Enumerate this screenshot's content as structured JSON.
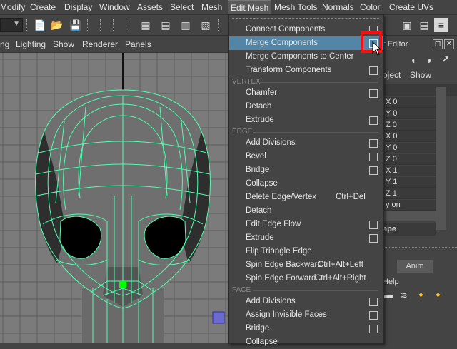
{
  "menubar": {
    "items": [
      "Modify",
      "Create",
      "Display",
      "Window",
      "Assets",
      "Select",
      "Mesh",
      "Edit Mesh",
      "Mesh Tools",
      "Normals",
      "Color",
      "Create UVs"
    ],
    "active": "Edit Mesh"
  },
  "viewport_menu": {
    "items": [
      "ng",
      "Lighting",
      "Show",
      "Renderer",
      "Panels"
    ]
  },
  "right_panel": {
    "title_fragment": "r Editor",
    "tab_object": "oject",
    "tab_show": "Show",
    "attr_rows": [
      "X 0",
      "Y 0",
      "Z 0",
      "X 0",
      "Y 0",
      "Z 0",
      "X 1",
      "Y 1",
      "Z 1",
      "y on"
    ],
    "section_label": "ape",
    "tab_anim": "Anim",
    "help_label": "Help"
  },
  "edit_mesh_menu": {
    "items": [
      {
        "label": "Connect Components",
        "option": true
      },
      {
        "label": "Merge Components",
        "option": true,
        "highlighted": true
      },
      {
        "label": "Merge Components to Center",
        "option": false
      },
      {
        "label": "Transform Components",
        "option": true
      },
      {
        "section": "VERTEX"
      },
      {
        "label": "Chamfer",
        "option": true
      },
      {
        "label": "Detach",
        "option": false
      },
      {
        "label": "Extrude",
        "option": true
      },
      {
        "section": "EDGE"
      },
      {
        "label": "Add Divisions",
        "option": true
      },
      {
        "label": "Bevel",
        "option": true
      },
      {
        "label": "Bridge",
        "option": true
      },
      {
        "label": "Collapse",
        "option": false
      },
      {
        "label": "Delete Edge/Vertex",
        "shortcut": "Ctrl+Del",
        "option": false
      },
      {
        "label": "Detach",
        "option": false
      },
      {
        "label": "Edit Edge Flow",
        "option": true
      },
      {
        "label": "Extrude",
        "option": true
      },
      {
        "label": "Flip Triangle Edge",
        "option": false
      },
      {
        "label": "Spin Edge Backward",
        "shortcut": "Ctrl+Alt+Left",
        "option": false
      },
      {
        "label": "Spin Edge Forward",
        "shortcut": "Ctrl+Alt+Right",
        "option": false
      },
      {
        "section": "FACE"
      },
      {
        "label": "Add Divisions",
        "option": true
      },
      {
        "label": "Assign Invisible Faces",
        "option": true
      },
      {
        "label": "Bridge",
        "option": true
      },
      {
        "label": "Collapse",
        "option": false
      }
    ]
  },
  "colors": {
    "menu_highlight": "#5285a6",
    "wireframe": "#4dffb0",
    "callout": "#ff0d0d",
    "grid": "#5e5e5e",
    "viewport_bg": "#7b7b7b"
  },
  "icons": [
    "magnet-icon",
    "folder-open-icon",
    "save-icon",
    "select-tool-icon",
    "render-icon",
    "option-box-icon",
    "cursor-icon",
    "mesh-head-model"
  ]
}
